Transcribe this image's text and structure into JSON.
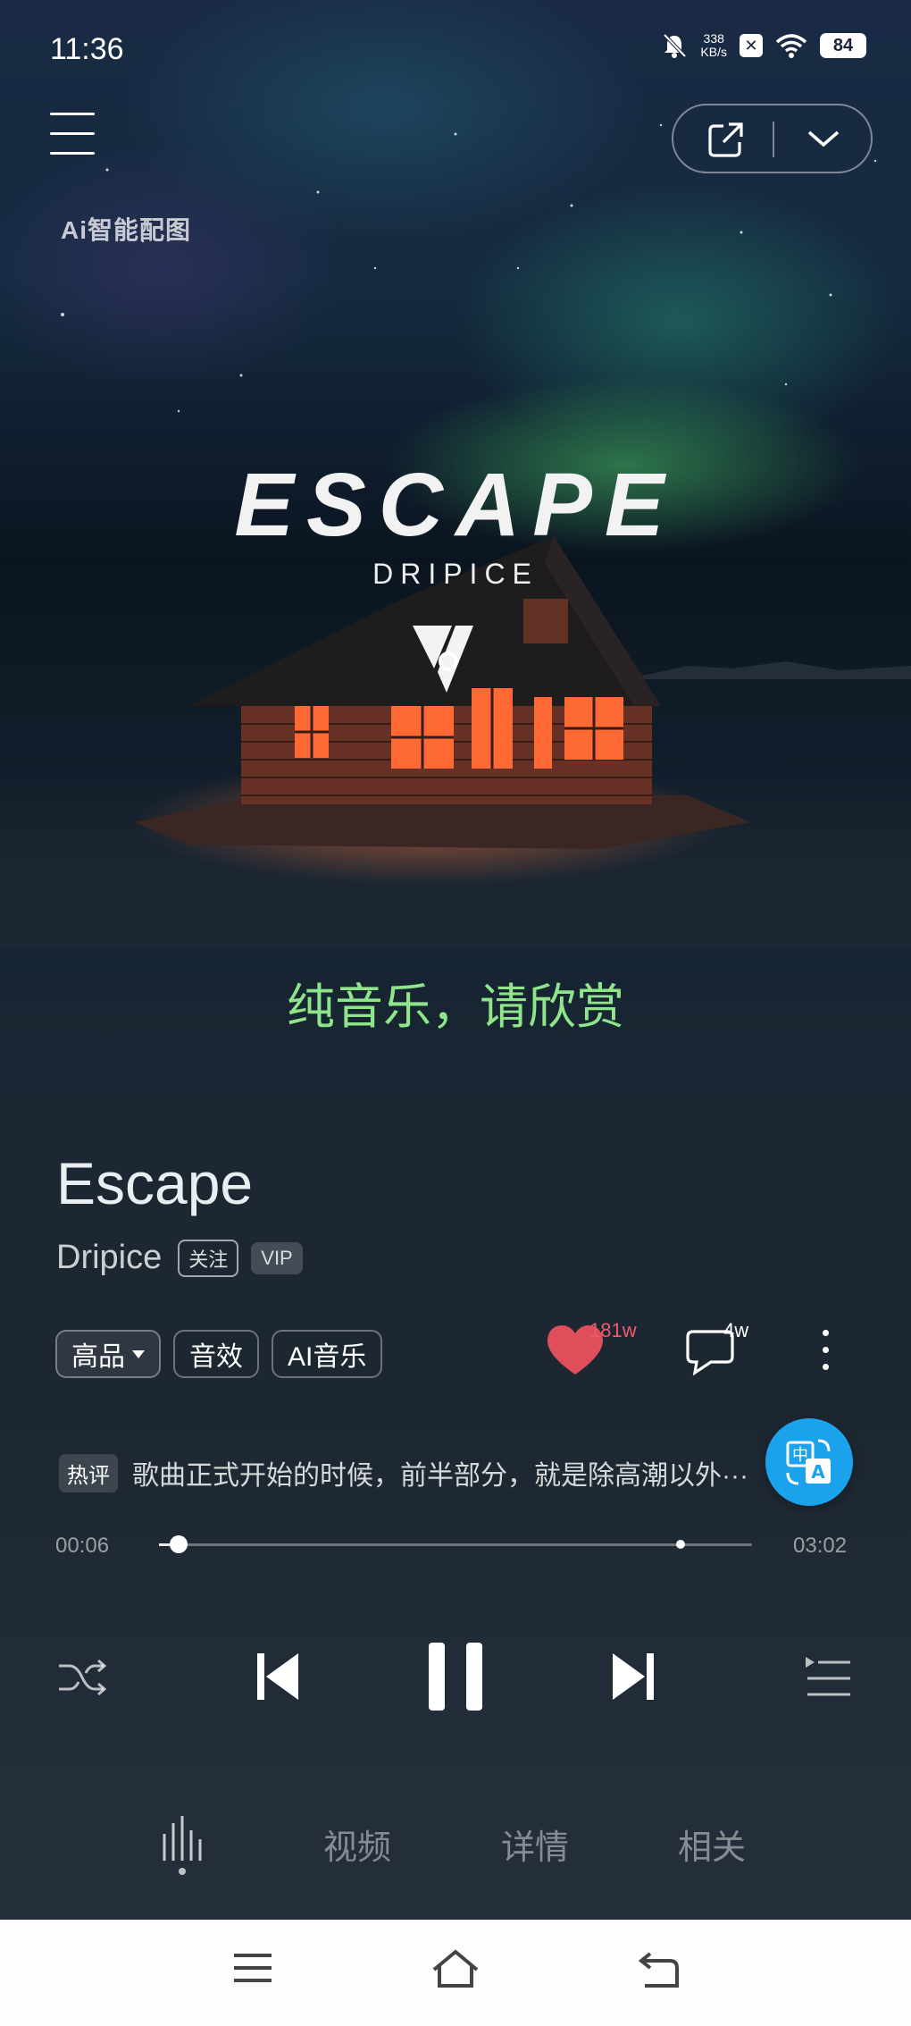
{
  "status_bar": {
    "time": "11:36",
    "net_speed_value": "338",
    "net_speed_unit": "KB/s",
    "battery": "84"
  },
  "header": {
    "ai_badge": "Ai智能配图"
  },
  "artwork": {
    "title": "ESCAPE",
    "subtitle": "DRIPICE"
  },
  "lyric": "纯音乐，请欣赏",
  "song": {
    "title": "Escape",
    "artist": "Dripice",
    "follow_label": "关注",
    "vip_label": "VIP"
  },
  "chips": [
    {
      "label": "高品"
    },
    {
      "label": "音效"
    },
    {
      "label": "AI音乐"
    }
  ],
  "actions": {
    "like_count": "181w",
    "comment_count": "4w"
  },
  "hot_comment": {
    "tag": "热评",
    "text": "歌曲正式开始的时候，前半部分，就是除高潮以外···"
  },
  "progress": {
    "current": "00:06",
    "total": "03:02",
    "played_fraction": 0.033,
    "marker_fraction": 0.88
  },
  "tabs": [
    {
      "label": "视频"
    },
    {
      "label": "详情"
    },
    {
      "label": "相关"
    }
  ],
  "colors": {
    "lyric": "#8ee58a",
    "like": "#e04e5c",
    "translate_fab": "#1aa3ec"
  }
}
